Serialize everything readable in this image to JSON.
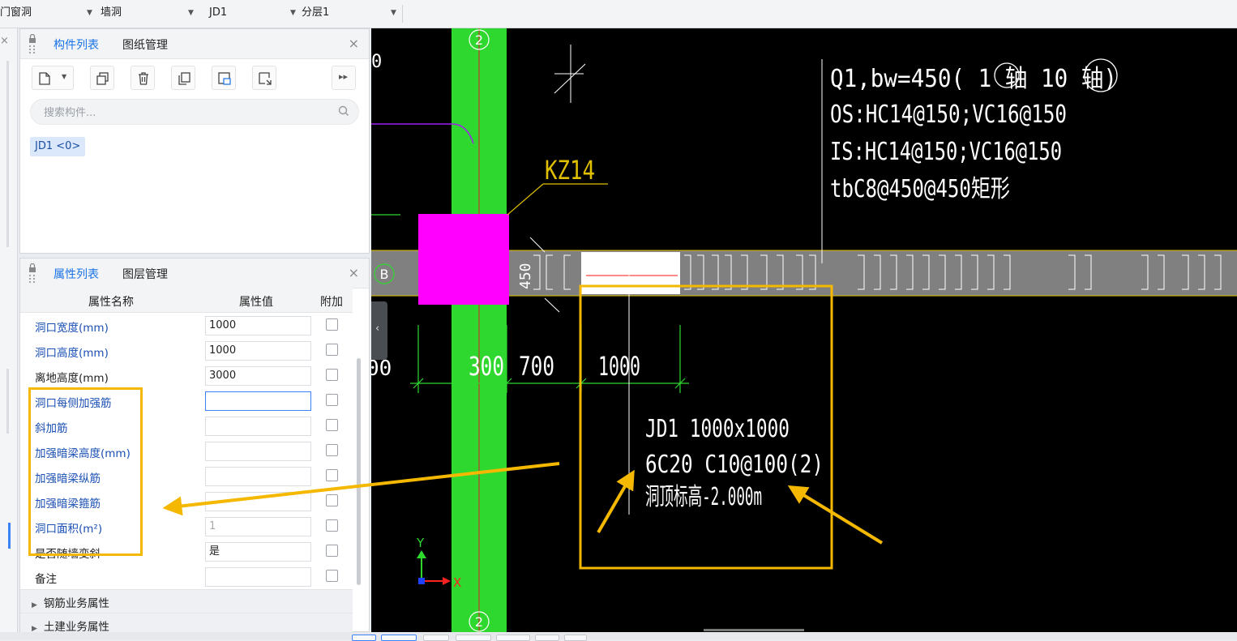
{
  "toolbar": {
    "selects": [
      {
        "value": "门窗洞"
      },
      {
        "value": "墙洞"
      },
      {
        "value": "JD1"
      },
      {
        "value": "分层1"
      }
    ]
  },
  "component_panel": {
    "tabs": [
      "构件列表",
      "图纸管理"
    ],
    "active_tab": "构件列表",
    "search_placeholder": "搜索构件...",
    "items": [
      "JD1 <0>"
    ],
    "icons": [
      "new-component-icon",
      "copy-icon",
      "delete-icon",
      "duplicate-layer-icon",
      "save-template-icon",
      "load-template-icon",
      "more-icon"
    ]
  },
  "property_panel": {
    "tabs": [
      "属性列表",
      "图层管理"
    ],
    "active_tab": "属性列表",
    "columns": [
      "属性名称",
      "属性值",
      "附加"
    ],
    "rows": [
      {
        "name": "洞口宽度(mm)",
        "value": "1000",
        "blue": true
      },
      {
        "name": "洞口高度(mm)",
        "value": "1000",
        "blue": true
      },
      {
        "name": "离地高度(mm)",
        "value": "3000",
        "blue": false
      },
      {
        "name": "洞口每侧加强筋",
        "value": "",
        "blue": true,
        "focused": true
      },
      {
        "name": "斜加筋",
        "value": "",
        "blue": true
      },
      {
        "name": "加强暗梁高度(mm)",
        "value": "",
        "blue": true
      },
      {
        "name": "加强暗梁纵筋",
        "value": "",
        "blue": true
      },
      {
        "name": "加强暗梁箍筋",
        "value": "",
        "blue": true
      },
      {
        "name": "洞口面积(m²)",
        "value": "1",
        "blue": true,
        "disabled": true
      },
      {
        "name": "是否随墙变斜",
        "value": "是",
        "blue": false
      },
      {
        "name": "备注",
        "value": "",
        "blue": false
      }
    ],
    "groups": [
      "钢筋业务属性",
      "土建业务属性"
    ]
  },
  "cad": {
    "axis_labels": {
      "grid_top": "2",
      "grid_bottom": "2",
      "grid_left": "B"
    },
    "column_label": "KZ14",
    "wall_note": [
      "Q1,bw=450( 1 轴 10 轴)",
      "OS:HC14@150;VC16@150",
      "IS:HC14@150;VC16@150",
      "tbC8@450@450矩形"
    ],
    "wall_thickness": "450",
    "dims": [
      "300",
      "700",
      "1000"
    ],
    "left_edge_fragments": [
      "0",
      "00"
    ],
    "opening_note": [
      "JD1 1000x1000",
      "6C20 C10@100(2)",
      "洞顶标高-2.000m"
    ],
    "ucs": {
      "y": "Y",
      "x": "X"
    },
    "colors": {
      "background": "#000000",
      "column_green": "#2fd82f",
      "column_magenta": "#ff00ff",
      "wall_gray": "#808080",
      "highlight_orange": "#f5b800",
      "text_white": "#ffffff",
      "text_yellow": "#e0c000"
    }
  }
}
